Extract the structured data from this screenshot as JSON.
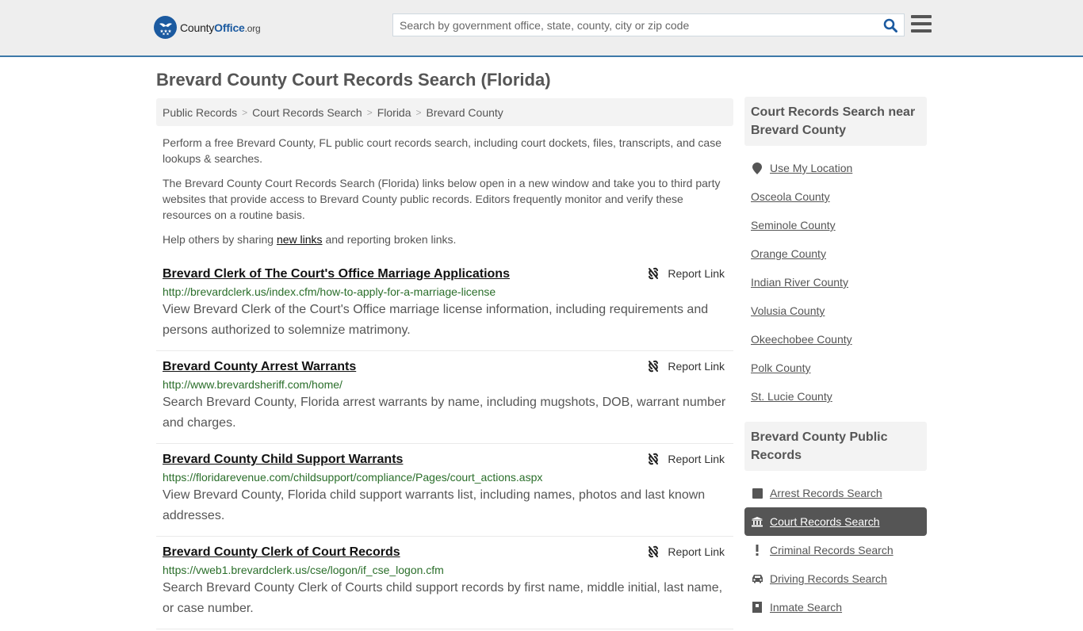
{
  "header": {
    "logo": {
      "brand_main": "County",
      "brand_accent": "Office",
      "brand_suffix": ".org"
    },
    "search": {
      "placeholder": "Search by government office, state, county, city or zip code",
      "value": "",
      "icon": "search-icon"
    },
    "menu_icon": "hamburger-menu-icon"
  },
  "page": {
    "title": "Brevard County Court Records Search (Florida)"
  },
  "breadcrumb": [
    {
      "label": "Public Records"
    },
    {
      "label": "Court Records Search"
    },
    {
      "label": "Florida"
    },
    {
      "label": "Brevard County"
    }
  ],
  "intro": {
    "p1": "Perform a free Brevard County, FL public court records search, including court dockets, files, transcripts, and case lookups & searches.",
    "p2": "The Brevard County Court Records Search (Florida) links below open in a new window and take you to third party websites that provide access to Brevard County public records. Editors frequently monitor and verify these resources on a routine basis.",
    "p3_before": "Help others by sharing ",
    "p3_link": "new links",
    "p3_after": " and reporting broken links."
  },
  "results": [
    {
      "title": "Brevard Clerk of The Court's Office Marriage Applications",
      "url": "http://brevardclerk.us/index.cfm/how-to-apply-for-a-marriage-license",
      "description": "View Brevard Clerk of the Court's Office marriage license information, including requirements and persons authorized to solemnize matrimony.",
      "report_label": "Report Link"
    },
    {
      "title": "Brevard County Arrest Warrants",
      "url": "http://www.brevardsheriff.com/home/",
      "description": "Search Brevard County, Florida arrest warrants by name, including mugshots, DOB, warrant number and charges.",
      "report_label": "Report Link"
    },
    {
      "title": "Brevard County Child Support Warrants",
      "url": "https://floridarevenue.com/childsupport/compliance/Pages/court_actions.aspx",
      "description": "View Brevard County, Florida child support warrants list, including names, photos and last known addresses.",
      "report_label": "Report Link"
    },
    {
      "title": "Brevard County Clerk of Court Records",
      "url": "https://vweb1.brevardclerk.us/cse/logon/if_cse_logon.cfm",
      "description": "Search Brevard County Clerk of Courts child support records by first name, middle initial, last name, or case number.",
      "report_label": "Report Link"
    }
  ],
  "sidebar": {
    "nearby": {
      "heading": "Court Records Search near Brevard County",
      "use_location": "Use My Location",
      "counties": [
        "Osceola County",
        "Seminole County",
        "Orange County",
        "Indian River County",
        "Volusia County",
        "Okeechobee County",
        "Polk County",
        "St. Lucie County"
      ]
    },
    "public_records": {
      "heading": "Brevard County Public Records",
      "items": [
        {
          "label": "Arrest Records Search",
          "icon": "square-icon",
          "active": false
        },
        {
          "label": "Court Records Search",
          "icon": "courthouse-icon",
          "active": true
        },
        {
          "label": "Criminal Records Search",
          "icon": "exclamation-icon",
          "active": false
        },
        {
          "label": "Driving Records Search",
          "icon": "car-icon",
          "active": false
        },
        {
          "label": "Inmate Search",
          "icon": "inmate-icon",
          "active": false
        }
      ]
    }
  },
  "colors": {
    "header_bg": "#eeeeee",
    "header_border": "#3d78a8",
    "brand_blue": "#1b5aa0",
    "url_green": "#2a6e2a",
    "active_item_bg": "#555555"
  }
}
